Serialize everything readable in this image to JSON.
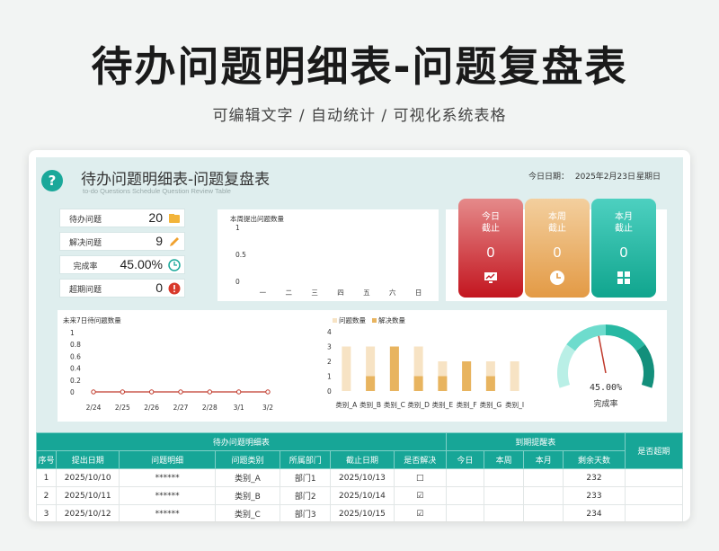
{
  "banner": {
    "title": "待办问题明细表-问题复盘表",
    "subtitle": "可编辑文字 / 自动统计 / 可视化系统表格"
  },
  "sheet": {
    "title": "待办问题明细表-问题复盘表",
    "subtitle": "to-do Questions Schedule Question Review Table",
    "date_label": "今日日期：",
    "date_value": "2025年2月23日",
    "weekday": "星期日"
  },
  "stats": [
    {
      "label": "待办问题",
      "value": "20",
      "icon": "folder-icon"
    },
    {
      "label": "解决问题",
      "value": "9",
      "icon": "pencil-icon"
    },
    {
      "label": "完成率",
      "value": "45.00%",
      "icon": "clock-icon"
    },
    {
      "label": "超期问题",
      "value": "0",
      "icon": "alert-icon"
    }
  ],
  "tiles": [
    {
      "line1": "今日",
      "line2": "截止",
      "value": "0",
      "icon": "monitor-chart-icon",
      "color": "#d9393e"
    },
    {
      "line1": "本周",
      "line2": "截止",
      "value": "0",
      "icon": "clock-icon",
      "color": "#e9a45a"
    },
    {
      "line1": "本月",
      "line2": "截止",
      "value": "0",
      "icon": "grid-icon",
      "color": "#1fb8a4"
    }
  ],
  "chart_data": [
    {
      "type": "bar",
      "title": "本周提出问题数量",
      "categories": [
        "一",
        "二",
        "三",
        "四",
        "五",
        "六",
        "日"
      ],
      "values": [
        0,
        0,
        0,
        0,
        0,
        0,
        0
      ],
      "ylim": [
        0,
        1
      ],
      "yticks": [
        "1",
        "0.5",
        "0"
      ]
    },
    {
      "type": "line",
      "title": "未来7日待问题数量",
      "categories": [
        "2/24",
        "2/25",
        "2/26",
        "2/27",
        "2/28",
        "3/1",
        "3/2"
      ],
      "values": [
        0,
        0,
        0,
        0,
        0,
        0,
        0
      ],
      "ylim": [
        0,
        1
      ],
      "yticks": [
        "1",
        "0.8",
        "0.6",
        "0.4",
        "0.2",
        "0"
      ],
      "color": "#c0392b"
    },
    {
      "type": "bar",
      "legend": [
        "问题数量",
        "解决数量"
      ],
      "categories": [
        "类别_A",
        "类别_B",
        "类别_C",
        "类别_D",
        "类别_E",
        "类别_F",
        "类别_G",
        "类别_I"
      ],
      "series": [
        {
          "name": "问题数量",
          "values": [
            3,
            3,
            3,
            3,
            2,
            2,
            2,
            2
          ],
          "color": "#f7e3c4"
        },
        {
          "name": "解决数量",
          "values": [
            0,
            1,
            3,
            1,
            1,
            2,
            1,
            0
          ],
          "color": "#e8b45f"
        }
      ],
      "ylim": [
        0,
        4
      ],
      "yticks": [
        "4",
        "3",
        "2",
        "1",
        "0"
      ]
    },
    {
      "type": "gauge",
      "value": 0.45,
      "value_label": "45.00%",
      "label": "完成率",
      "colors": [
        "#b9efe6",
        "#6edccd",
        "#27b8a2",
        "#138f7b"
      ]
    }
  ],
  "table": {
    "group_headers": [
      "待办问题明细表",
      "到期提醒表",
      "是否超期"
    ],
    "columns": [
      "序号",
      "提出日期",
      "问题明细",
      "问题类别",
      "所属部门",
      "截止日期",
      "是否解决",
      "今日",
      "本周",
      "本月",
      "剩余天数"
    ],
    "rows": [
      {
        "no": "1",
        "date": "2025/10/10",
        "detail": "******",
        "cat": "类别_A",
        "dept": "部门1",
        "due": "2025/10/13",
        "solved": "□",
        "today": "",
        "week": "",
        "month": "",
        "days": "232",
        "overdue": ""
      },
      {
        "no": "2",
        "date": "2025/10/11",
        "detail": "******",
        "cat": "类别_B",
        "dept": "部门2",
        "due": "2025/10/14",
        "solved": "☑",
        "today": "",
        "week": "",
        "month": "",
        "days": "233",
        "overdue": ""
      },
      {
        "no": "3",
        "date": "2025/10/12",
        "detail": "******",
        "cat": "类别_C",
        "dept": "部门3",
        "due": "2025/10/15",
        "solved": "☑",
        "today": "",
        "week": "",
        "month": "",
        "days": "234",
        "overdue": ""
      }
    ]
  }
}
